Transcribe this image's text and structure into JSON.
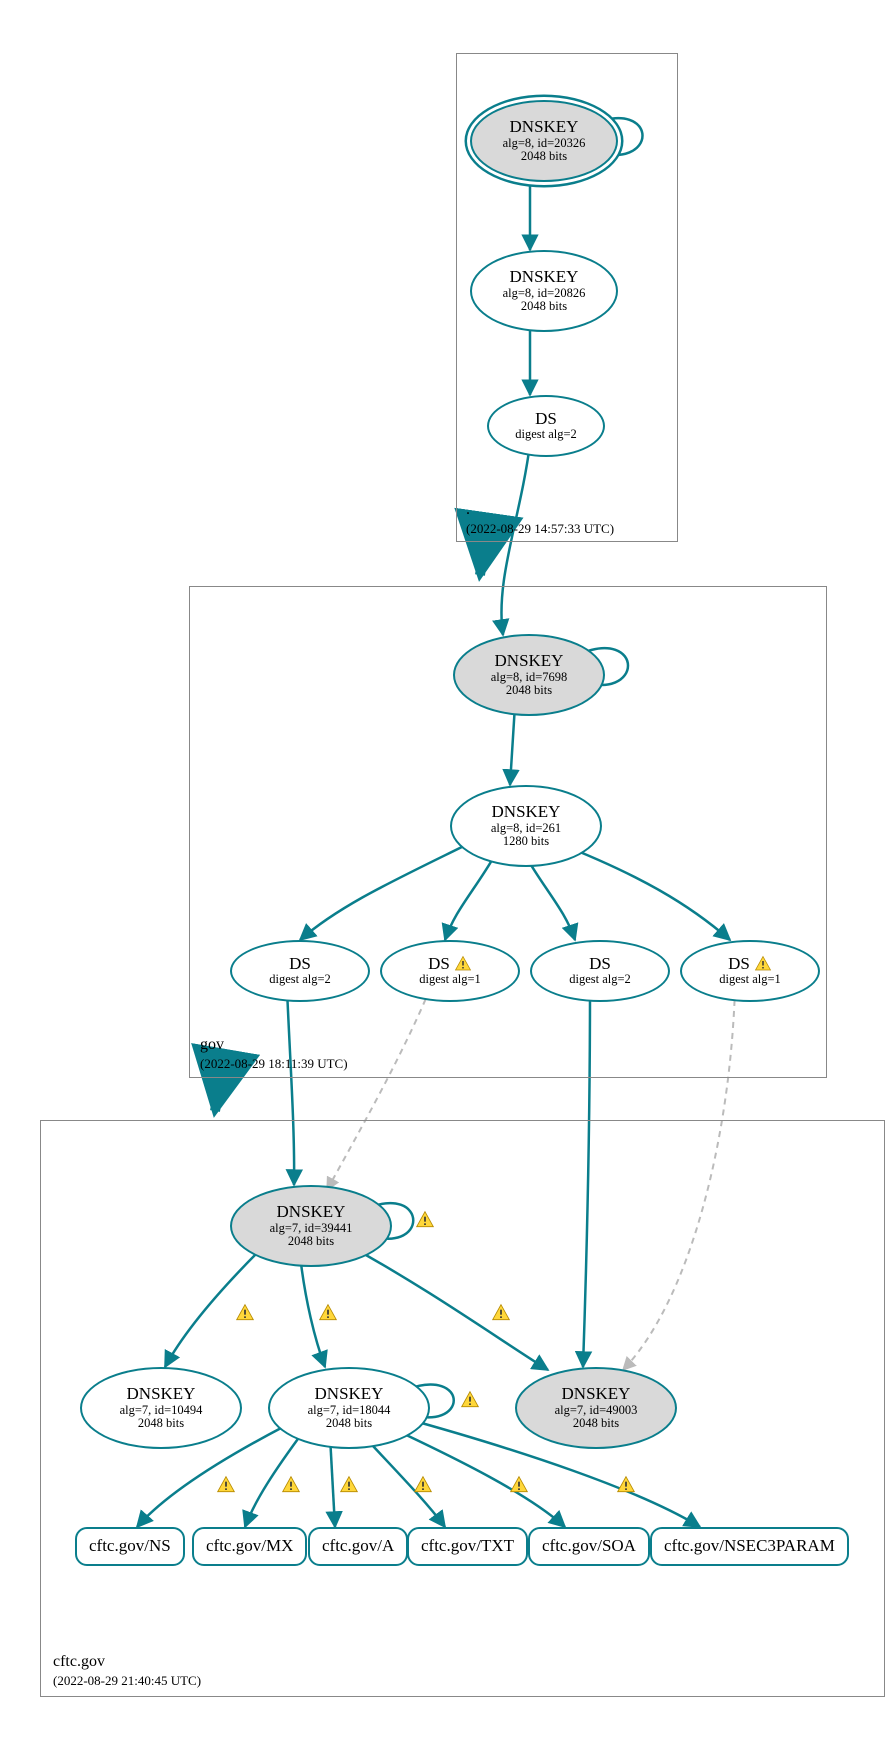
{
  "zones": {
    "root": {
      "label": ".",
      "timestamp": "(2022-08-29 14:57:33 UTC)"
    },
    "gov": {
      "label": "gov",
      "timestamp": "(2022-08-29 18:11:39 UTC)"
    },
    "cftc": {
      "label": "cftc.gov",
      "timestamp": "(2022-08-29 21:40:45 UTC)"
    }
  },
  "nodes": {
    "root_ksk": {
      "title": "DNSKEY",
      "sub1": "alg=8, id=20326",
      "sub2": "2048 bits"
    },
    "root_zsk": {
      "title": "DNSKEY",
      "sub1": "alg=8, id=20826",
      "sub2": "2048 bits"
    },
    "root_ds": {
      "title": "DS",
      "sub1": "digest alg=2",
      "sub2": ""
    },
    "gov_ksk": {
      "title": "DNSKEY",
      "sub1": "alg=8, id=7698",
      "sub2": "2048 bits"
    },
    "gov_zsk": {
      "title": "DNSKEY",
      "sub1": "alg=8, id=261",
      "sub2": "1280 bits"
    },
    "gov_ds1": {
      "title": "DS",
      "sub1": "digest alg=2",
      "sub2": ""
    },
    "gov_ds2": {
      "title": "DS",
      "sub1": "digest alg=1",
      "sub2": ""
    },
    "gov_ds3": {
      "title": "DS",
      "sub1": "digest alg=2",
      "sub2": ""
    },
    "gov_ds4": {
      "title": "DS",
      "sub1": "digest alg=1",
      "sub2": ""
    },
    "cftc_ksk": {
      "title": "DNSKEY",
      "sub1": "alg=7, id=39441",
      "sub2": "2048 bits"
    },
    "cftc_k2": {
      "title": "DNSKEY",
      "sub1": "alg=7, id=10494",
      "sub2": "2048 bits"
    },
    "cftc_zsk": {
      "title": "DNSKEY",
      "sub1": "alg=7, id=18044",
      "sub2": "2048 bits"
    },
    "cftc_k4": {
      "title": "DNSKEY",
      "sub1": "alg=7, id=49003",
      "sub2": "2048 bits"
    },
    "rr_ns": {
      "title": "cftc.gov/NS"
    },
    "rr_mx": {
      "title": "cftc.gov/MX"
    },
    "rr_a": {
      "title": "cftc.gov/A"
    },
    "rr_txt": {
      "title": "cftc.gov/TXT"
    },
    "rr_soa": {
      "title": "cftc.gov/SOA"
    },
    "rr_n3p": {
      "title": "cftc.gov/NSEC3PARAM"
    }
  }
}
